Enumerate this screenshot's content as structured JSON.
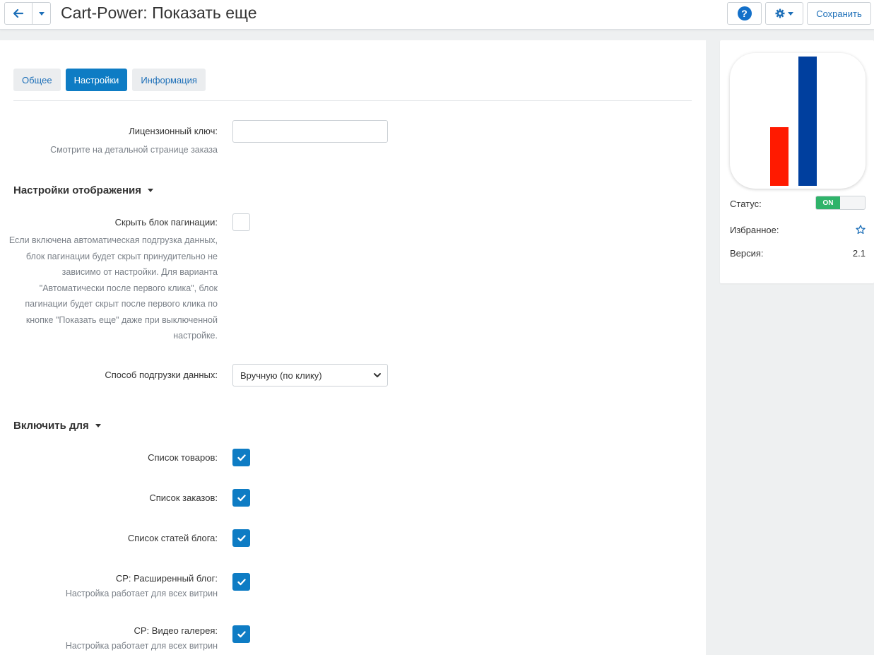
{
  "header": {
    "title": "Cart-Power: Показать еще",
    "save_label": "Сохранить"
  },
  "tabs": [
    {
      "label": "Общее",
      "active": false
    },
    {
      "label": "Настройки",
      "active": true
    },
    {
      "label": "Информация",
      "active": false
    }
  ],
  "license": {
    "label": "Лицензионный ключ:",
    "hint": "Смотрите на детальной странице заказа",
    "value": ""
  },
  "display_section": {
    "title": "Настройки отображения",
    "hide_pagination_label": "Скрыть блок пагинации:",
    "hide_pagination_checked": false,
    "hide_pagination_hint": "Если включена автоматическая подгрузка данных, блок пагинации будет скрыт принудительно не зависимо от настройки. Для варианта \"Автоматически после первого клика\", блок пагинации будет скрыт после первого клика по кнопке \"Показать еще\" даже при выключенной настройке.",
    "load_method_label": "Способ подгрузки данных:",
    "load_method_value": "Вручную (по клику)"
  },
  "enable_section": {
    "title": "Включить для",
    "items": [
      {
        "label": "Список товаров:",
        "checked": true,
        "hint": ""
      },
      {
        "label": "Список заказов:",
        "checked": true,
        "hint": ""
      },
      {
        "label": "Список статей блога:",
        "checked": true,
        "hint": ""
      },
      {
        "label": "CP: Расширенный блог:",
        "checked": true,
        "hint": "Настройка работает для всех витрин"
      },
      {
        "label": "CP: Видео галерея:",
        "checked": true,
        "hint": "Настройка работает для всех витрин"
      }
    ]
  },
  "sidebar": {
    "status_label": "Статус:",
    "status_value": "ON",
    "favorite_label": "Избранное:",
    "version_label": "Версия:",
    "version_value": "2.1"
  },
  "colors": {
    "accent": "#0e7cc4",
    "logo_red": "#ff1a00",
    "logo_blue": "#003f9e",
    "toggle_on": "#2fb36a"
  }
}
